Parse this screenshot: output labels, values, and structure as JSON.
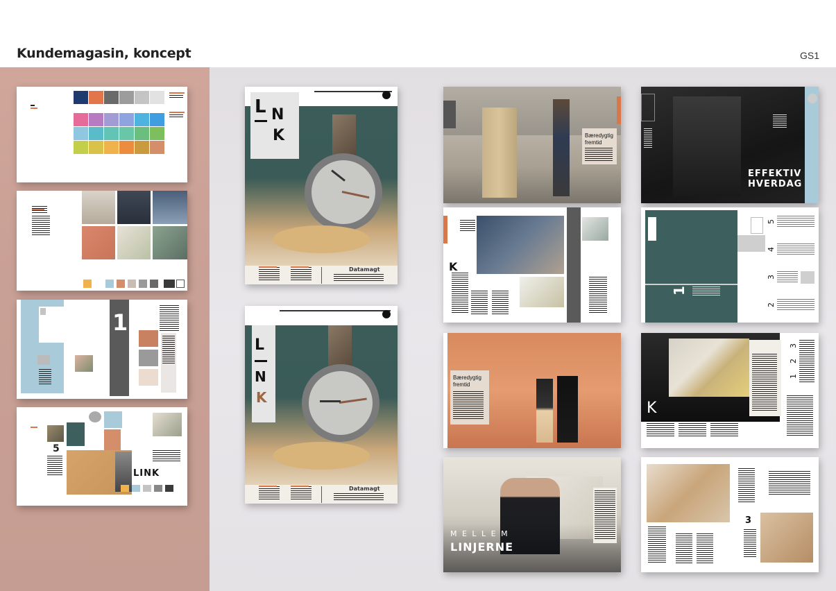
{
  "header": {
    "title": "Kundemagasin, koncept",
    "code": "GS1"
  },
  "colors": {
    "left_panel": "#c9a095",
    "main_panel": "#e6e4e7",
    "cover_teal": "#3b5c59",
    "accent_orange": "#d9774a",
    "palette_row1": [
      "#1f3a6e",
      "#e2754a",
      "#6a6a6a",
      "#9c9c9c",
      "#c4c4c4",
      "#e2e2e2"
    ],
    "palette_row2": [
      "#e76b9a",
      "#b67bc1",
      "#a39bd4",
      "#8ea3e0",
      "#4fb3e0",
      "#3f9de0"
    ],
    "palette_row3": [
      "#8fc6e0",
      "#5bbcc9",
      "#62c4b4",
      "#69c7a8",
      "#6abf7f",
      "#7ebf5d"
    ],
    "palette_row4": [
      "#c3cf4a",
      "#d8c24a",
      "#f0b24a",
      "#ec8c3e",
      "#c99a3e",
      "#d48f6a"
    ]
  },
  "cover": {
    "logo_letters": [
      "L",
      "N",
      "K"
    ],
    "logo_letters_alt": [
      "L",
      "N",
      "K"
    ],
    "feature": "Datamagt"
  },
  "spreads": {
    "story_heading": "Bæredygtig fremtid",
    "effektiv": "EFFEKTIV",
    "hverdag": "HVERDAG",
    "num_1": "1",
    "num_2": "2",
    "num_3": "3",
    "num_4": "4",
    "num_5": "5",
    "drop_k": "K",
    "mellem": "M E L L E M",
    "linjerne": "LINJERNE",
    "link_word": "LINK",
    "big_one": "1"
  }
}
